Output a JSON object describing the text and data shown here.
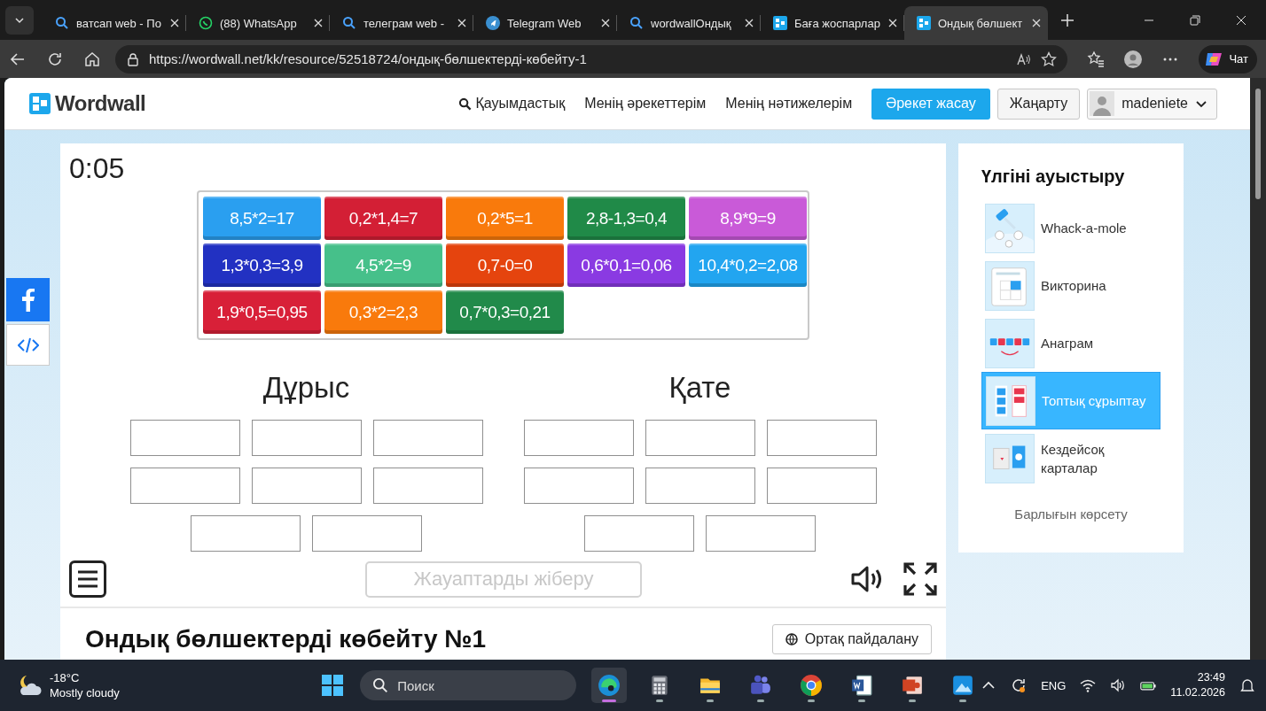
{
  "browser": {
    "tabs": [
      {
        "title": "ватсап web - По",
        "kind": "search",
        "selected": false
      },
      {
        "title": "(88) WhatsApp",
        "kind": "whatsapp",
        "selected": false
      },
      {
        "title": "телеграм web -",
        "kind": "search",
        "selected": false
      },
      {
        "title": "Telegram Web",
        "kind": "telegram",
        "selected": false
      },
      {
        "title": "wordwallОндық",
        "kind": "search",
        "selected": false
      },
      {
        "title": "Баға жоспарлар",
        "kind": "wordwall",
        "selected": false
      },
      {
        "title": "Ондық бөлшект",
        "kind": "wordwall",
        "selected": true
      }
    ],
    "url": "https://wordwall.net/kk/resource/52518724/ондық-бөлшектерді-көбейту-1",
    "chat_label": "Чат"
  },
  "header": {
    "logo": "Wordwall",
    "nav": [
      {
        "label": "Қауымдастық",
        "kind": "search"
      },
      {
        "label": "Менің әрекеттерім",
        "kind": "link"
      },
      {
        "label": "Менің нәтижелерім",
        "kind": "link"
      },
      {
        "label": "Әрекет жасау",
        "kind": "primary"
      },
      {
        "label": "Жаңарту",
        "kind": "secondary"
      }
    ],
    "user": "madeniete"
  },
  "game": {
    "timer": "0:05",
    "tiles": [
      {
        "text": "8,5*2=17",
        "color": "#2a9ff0"
      },
      {
        "text": "0,2*1,4=7",
        "color": "#d31f35"
      },
      {
        "text": "0,2*5=1",
        "color": "#f97a0c"
      },
      {
        "text": "2,8-1,3=0,4",
        "color": "#208a48"
      },
      {
        "text": "8,9*9=9",
        "color": "#c95ad8"
      },
      {
        "text": "1,3*0,3=3,9",
        "color": "#2231c2"
      },
      {
        "text": "4,5*2=9",
        "color": "#46c08a"
      },
      {
        "text": "0,7-0=0",
        "color": "#e5440e"
      },
      {
        "text": "0,6*0,1=0,06",
        "color": "#8a3ae2"
      },
      {
        "text": "10,4*0,2=2,08",
        "color": "#22a5f0"
      },
      {
        "text": "1,9*0,5=0,95",
        "color": "#d82038"
      },
      {
        "text": "0,3*2=2,3",
        "color": "#f97a0c"
      },
      {
        "text": "0,7*0,3=0,21",
        "color": "#218a4a"
      }
    ],
    "groups": [
      {
        "title": "Дұрыс"
      },
      {
        "title": "Қате"
      }
    ],
    "submit": {
      "label": "Жауаптарды жіберу",
      "disabled": true
    }
  },
  "activity": {
    "title": "Ондық бөлшектерді көбейту №1",
    "share": "Ортақ пайдалану"
  },
  "sidebar": {
    "title": "Үлгіні ауыстыру",
    "templates": [
      {
        "name": "Whack-a-mole",
        "kind": "whack",
        "selected": false
      },
      {
        "name": "Викторина",
        "kind": "quiz",
        "selected": false
      },
      {
        "name": "Анаграм",
        "kind": "anagram",
        "selected": false
      },
      {
        "name": "Топтық сұрыптау",
        "kind": "group-sort",
        "selected": true
      },
      {
        "name": "Кездейсоқ карталар",
        "kind": "cards",
        "selected": false
      }
    ],
    "show_all": "Барлығын көрсету"
  },
  "taskbar": {
    "weather": {
      "temp": "-18°C",
      "condition": "Mostly cloudy"
    },
    "search": "Поиск",
    "apps": [
      {
        "kind": "edge",
        "selected": true
      },
      {
        "kind": "calculator",
        "selected": false
      },
      {
        "kind": "explorer",
        "selected": false
      },
      {
        "kind": "teams",
        "selected": false
      },
      {
        "kind": "chrome",
        "selected": false
      },
      {
        "kind": "word",
        "selected": false
      },
      {
        "kind": "presentation",
        "selected": false
      },
      {
        "kind": "photos",
        "selected": false
      }
    ],
    "language": "ENG",
    "time": "23:49",
    "date": "11.02.2026"
  }
}
